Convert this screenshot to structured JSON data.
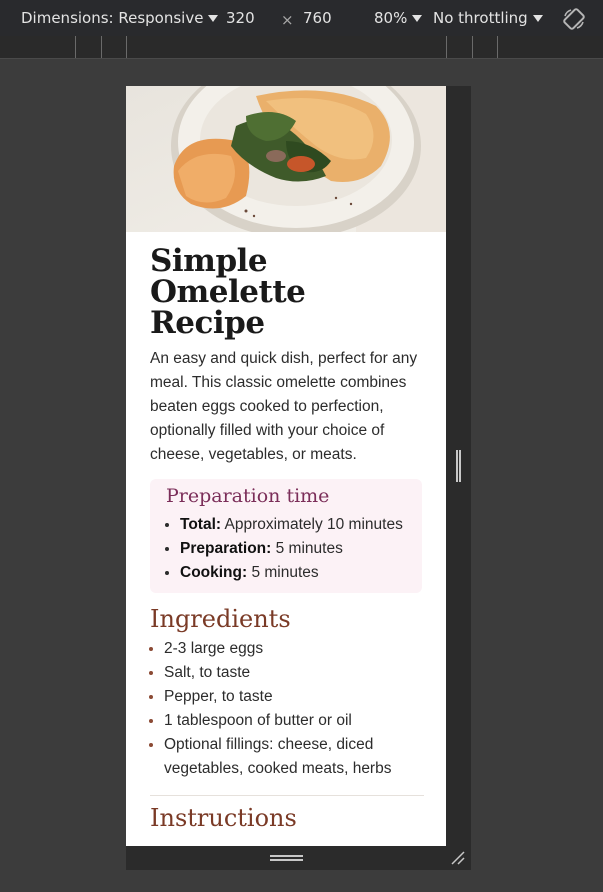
{
  "devtools": {
    "dimensions_label": "Dimensions: Responsive",
    "width": "320",
    "times": "×",
    "height": "760",
    "zoom": "80%",
    "throttling": "No throttling",
    "rotate_icon": "rotate-icon"
  },
  "recipe": {
    "title": "Simple Omelette Recipe",
    "description": "An easy and quick dish, perfect for any meal. This classic omelette combines beaten eggs cooked to perfection, optionally filled with your choice of cheese, vegetables, or meats.",
    "prep": {
      "title": "Preparation time",
      "items": [
        {
          "label": "Total:",
          "value": "Approximately 10 minutes"
        },
        {
          "label": "Preparation:",
          "value": "5 minutes"
        },
        {
          "label": "Cooking:",
          "value": "5 minutes"
        }
      ]
    },
    "ingredients": {
      "title": "Ingredients",
      "items": [
        "2-3 large eggs",
        "Salt, to taste",
        "Pepper, to taste",
        "1 tablespoon of butter or oil",
        "Optional fillings: cheese, diced vegetables, cooked meats, herbs"
      ]
    },
    "instructions": {
      "title": "Instructions"
    }
  },
  "colors": {
    "prep_bg": "#fcf2f6",
    "prep_title": "#7b2e59",
    "section_title": "#7a3a26"
  }
}
